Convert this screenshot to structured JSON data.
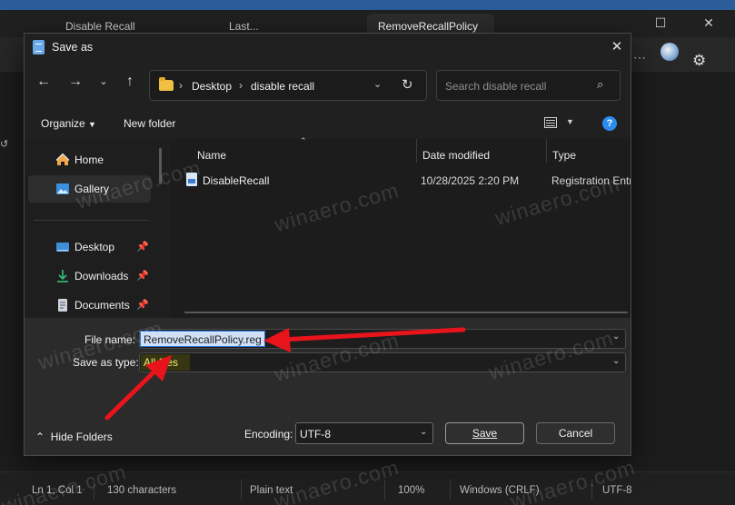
{
  "background_window": {
    "tabs": [
      "Disable Recall",
      "Last...",
      "RemoveRecallPolicy"
    ],
    "menu_more": "⋯",
    "status": {
      "position": "Ln 1, Col 1",
      "characters": "130 characters",
      "format": "Plain text",
      "zoom": "100%",
      "line_endings": "Windows (CRLF)",
      "encoding": "UTF-8"
    }
  },
  "dialog": {
    "title": "Save as",
    "address": {
      "crumbs": [
        "Desktop",
        "disable recall"
      ]
    },
    "search_placeholder": "Search disable recall",
    "commands": {
      "organize": "Organize",
      "new_folder": "New folder",
      "help": "?"
    },
    "nav": {
      "items": [
        {
          "label": "Home",
          "icon": "home-icon"
        },
        {
          "label": "Gallery",
          "icon": "gallery-icon",
          "selected": true
        },
        {
          "label": "Desktop",
          "icon": "desktop-icon",
          "pinned": true
        },
        {
          "label": "Downloads",
          "icon": "download-icon",
          "pinned": true
        },
        {
          "label": "Documents",
          "icon": "documents-icon",
          "pinned": true
        }
      ]
    },
    "columns": {
      "name": "Name",
      "date_modified": "Date modified",
      "type": "Type"
    },
    "files": [
      {
        "name": "DisableRecall",
        "date_modified": "10/28/2025 2:20 PM",
        "type": "Registration Entries"
      }
    ],
    "form": {
      "file_name_label": "File name:",
      "file_name_value": "RemoveRecallPolicy.reg",
      "save_as_type_label": "Save as type:",
      "save_as_type_value": "All files",
      "encoding_label": "Encoding:",
      "encoding_value": "UTF-8",
      "save_label": "Save",
      "cancel_label": "Cancel",
      "hide_folders_label": "Hide Folders"
    }
  },
  "watermark": "winaero.com",
  "colors": {
    "accent": "#2a8cf0",
    "highlight_yellow": "#fff8a6",
    "annotation_red": "#e8141c"
  }
}
